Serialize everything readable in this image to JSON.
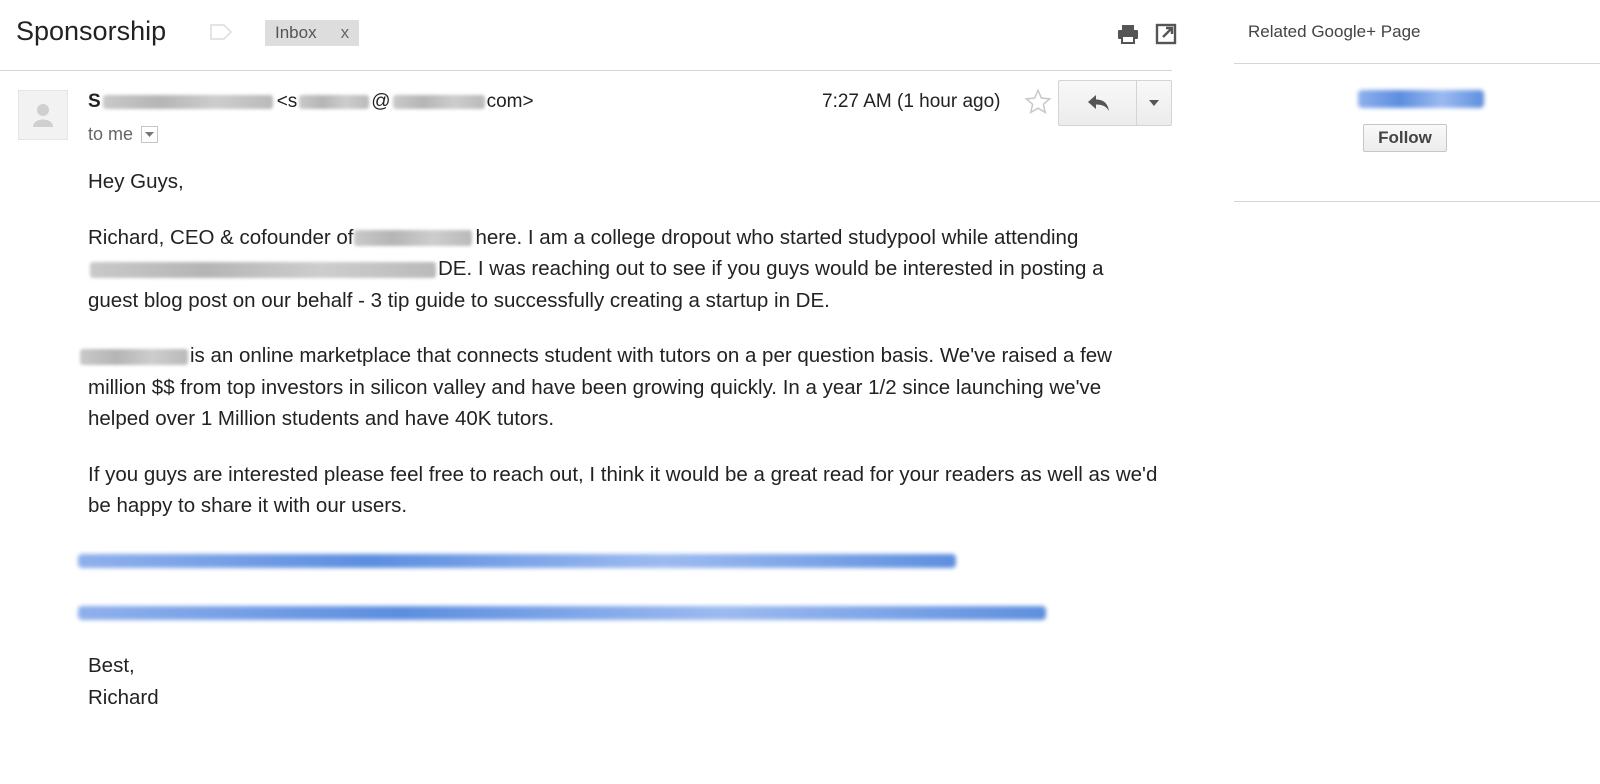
{
  "header": {
    "subject": "Sponsorship",
    "label_chip": "Inbox",
    "label_remove": "x",
    "icons": [
      "label-icon",
      "print-icon",
      "new-window-icon"
    ]
  },
  "message": {
    "sender_initial": "S",
    "sender_email_open": "<s",
    "sender_email_at": "@",
    "sender_email_tail": "com>",
    "recipient": "to me",
    "timestamp": "7:27 AM (1 hour ago)",
    "icons": [
      "avatar-icon",
      "star-icon",
      "reply-icon",
      "more-actions-icon",
      "details-dropdown-icon"
    ]
  },
  "body": {
    "greeting": "Hey Guys,",
    "p1_a": "Richard, CEO & cofounder of",
    "p1_b": "here. I am a college dropout who started studypool while attending",
    "p1_c": "DE.  I was reaching out to see if you guys would be interested in posting a guest blog post on our behalf - 3 tip guide to successfully creating a startup in DE.",
    "p2": "is an online marketplace that connects student with tutors on a per question basis.  We've raised a few million $$ from top investors in silicon valley and have been growing quickly.  In a year 1/2 since launching we've helped over 1 Million students and have 40K tutors.",
    "p3": "If you guys are interested please feel free to reach out, I think it would be a great read for your readers as well as we'd be happy to share it with our users.",
    "closing": "Best,",
    "signature": "Richard"
  },
  "sidebar": {
    "title": "Related Google+ Page",
    "follow_label": "Follow"
  },
  "colors": {
    "link_blue": "#5c8ee0",
    "divider": "#d6d6d6",
    "chip_bg": "#dddddd"
  }
}
